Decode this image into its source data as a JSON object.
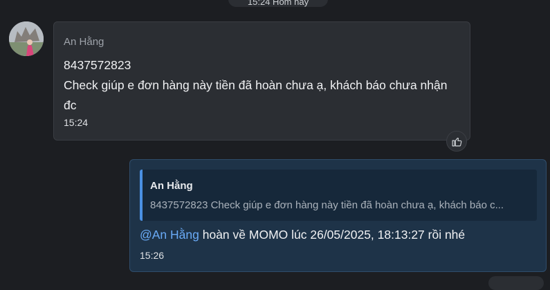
{
  "date_divider": "15:24 Hôm nay",
  "incoming": {
    "sender_name": "An Hằng",
    "lines": [
      "8437572823",
      "Check giúp e đơn hàng này tiền đã hoàn chưa ạ, khách báo chưa nhận đc"
    ],
    "time": "15:24",
    "like_icon": "thumbs-up-icon"
  },
  "outgoing": {
    "quote": {
      "name": "An Hằng",
      "text": "8437572823 Check giúp e đơn hàng này tiền đã hoàn chưa ạ, khách báo c..."
    },
    "mention": "@An Hằng",
    "text": " hoàn về MOMO lúc 26/05/2025, 18:13:27 rồi nhé",
    "time": "15:26"
  },
  "colors": {
    "background": "#1c1e22",
    "incoming_bubble": "#2b2e33",
    "outgoing_bubble": "#1e3348",
    "mention": "#6aabf7",
    "quote_bar": "#4a90e2"
  }
}
